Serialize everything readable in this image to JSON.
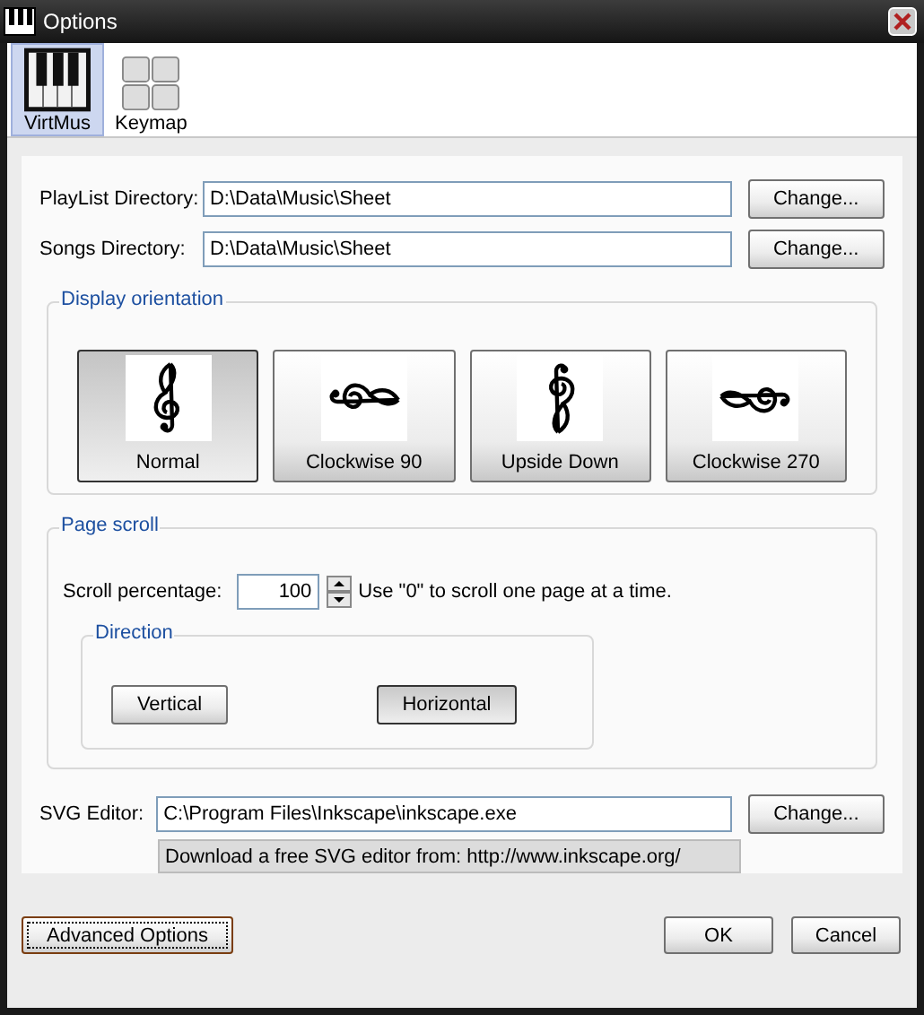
{
  "window": {
    "title": "Options"
  },
  "toolbar": [
    {
      "label": "VirtMus",
      "kind": "piano",
      "selected": true
    },
    {
      "label": "Keymap",
      "kind": "keys",
      "selected": false
    }
  ],
  "paths": [
    {
      "label": "PlayList Directory:",
      "value": "D:\\Data\\Music\\Sheet",
      "button": "Change..."
    },
    {
      "label": "Songs Directory:",
      "value": "D:\\Data\\Music\\Sheet",
      "button": "Change..."
    }
  ],
  "display_orientation": {
    "title": "Display orientation",
    "options": [
      {
        "label": "Normal",
        "kind": "normal",
        "selected": true
      },
      {
        "label": "Clockwise 90",
        "kind": "cw90",
        "selected": false
      },
      {
        "label": "Upside Down",
        "kind": "upside",
        "selected": false
      },
      {
        "label": "Clockwise 270",
        "kind": "cw270",
        "selected": false
      }
    ]
  },
  "page_scroll": {
    "title": "Page scroll",
    "label": "Scroll percentage:",
    "value": "100",
    "hint": "Use \"0\" to scroll one page at a time.",
    "direction": {
      "title": "Direction",
      "options": [
        {
          "label": "Vertical",
          "selected": false
        },
        {
          "label": "Horizontal",
          "selected": true
        }
      ]
    }
  },
  "svg_editor": {
    "label": "SVG Editor:",
    "value": "C:\\Program Files\\Inkscape\\inkscape.exe",
    "button": "Change...",
    "note": "Download a free SVG editor from: http://www.inkscape.org/"
  },
  "buttons": [
    {
      "label": "Advanced Options",
      "kind": "left",
      "focused": true
    },
    {
      "label": "OK",
      "kind": "right",
      "focused": false
    },
    {
      "label": "Cancel",
      "kind": "right",
      "focused": false
    }
  ]
}
